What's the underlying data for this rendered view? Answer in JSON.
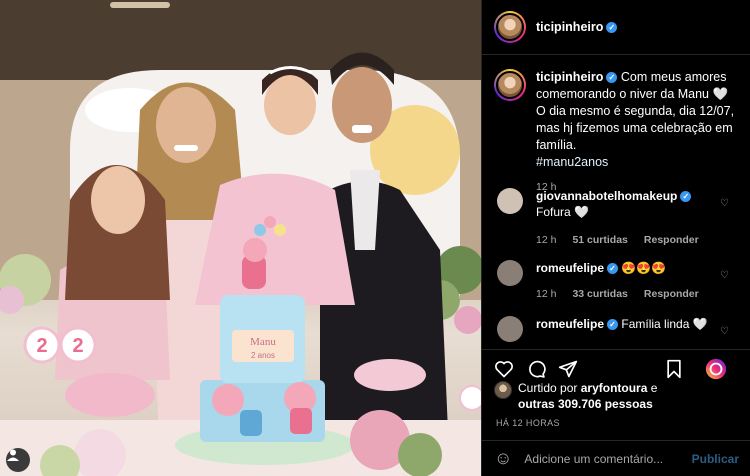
{
  "post": {
    "username": "ticipinheiro",
    "caption_text": "Com meus amores comemorando o niver da Manu 🤍 O dia mesmo é segunda, dia 12/07, mas hj fizemos uma celebração em família.",
    "hashtag": "#manu2anos",
    "caption_time": "12 h",
    "cake_text": "Manu",
    "cake_subtext": "2 anos"
  },
  "comments": [
    {
      "username": "giovannabotelhomakeup",
      "text": "Fofura 🤍",
      "time": "12 h",
      "likes": "51 curtidas",
      "reply": "Responder",
      "avatar_color": "#cfc2b5"
    },
    {
      "username": "romeufelipe",
      "text": "😍😍😍",
      "time": "12 h",
      "likes": "33 curtidas",
      "reply": "Responder",
      "avatar_color": "#8a7f76"
    },
    {
      "username": "romeufelipe",
      "text": "Família linda 🤍",
      "avatar_color": "#8a7f76"
    }
  ],
  "likes": {
    "prefix": "Curtido por",
    "user": "aryfontoura",
    "connector": "e",
    "others": "outras 309.706 pessoas"
  },
  "timestamp": "HÁ 12 HORAS",
  "add_comment": {
    "emoji": "☺",
    "placeholder": "Adicione um comentário...",
    "publish": "Publicar"
  },
  "balloons": [
    "2",
    "2"
  ],
  "colors": {
    "verified": "#3897f0",
    "publish": "#2b5d82",
    "background": "#000000"
  }
}
